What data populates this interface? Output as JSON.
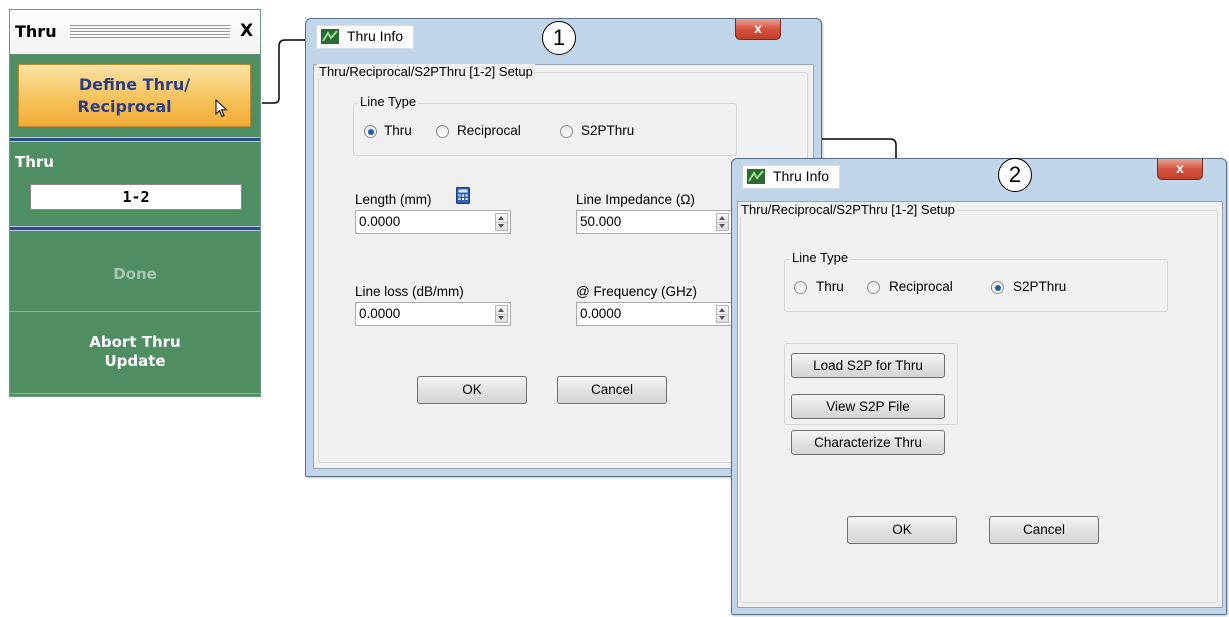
{
  "menu": {
    "title": "Thru",
    "close": "X",
    "define_button": [
      "Define Thru/",
      "Reciprocal"
    ],
    "thru_label": "Thru",
    "thru_value": "1-2",
    "done_button": "Done",
    "abort_button": [
      "Abort Thru",
      "Update"
    ]
  },
  "callouts": {
    "one": "1",
    "two": "2"
  },
  "dialog1": {
    "title": "Thru Info",
    "close": "x",
    "group_title": "Thru/Reciprocal/S2PThru [1-2] Setup",
    "line_type_label": "Line Type",
    "options": [
      "Thru",
      "Reciprocal",
      "S2PThru"
    ],
    "selected": "Thru",
    "length_label": "Length (mm)",
    "length_value": "0.0000",
    "impedance_label": "Line Impedance (Ω)",
    "impedance_value": "50.000",
    "loss_label": "Line loss (dB/mm)",
    "loss_value": "0.0000",
    "freq_label": "@ Frequency (GHz)",
    "freq_value": "0.0000",
    "ok": "OK",
    "cancel": "Cancel"
  },
  "dialog2": {
    "title": "Thru Info",
    "close": "x",
    "group_title": "Thru/Reciprocal/S2PThru [1-2] Setup",
    "line_type_label": "Line Type",
    "options": [
      "Thru",
      "Reciprocal",
      "S2PThru"
    ],
    "selected": "S2PThru",
    "load_button": "Load S2P for Thru",
    "view_button": "View S2P File",
    "characterize_button": "Characterize Thru",
    "ok": "OK",
    "cancel": "Cancel"
  },
  "colors": {
    "menu_green": "#4f8e62",
    "define_orange": "#f6c25c",
    "define_text": "#2b3f86",
    "separator_blue": "#2b4a86",
    "done_disabled": "#a8c6b1",
    "dialog_frame": "#c1d5ea",
    "close_red": "#d5533e",
    "radio_dot": "#1e5fb3"
  }
}
